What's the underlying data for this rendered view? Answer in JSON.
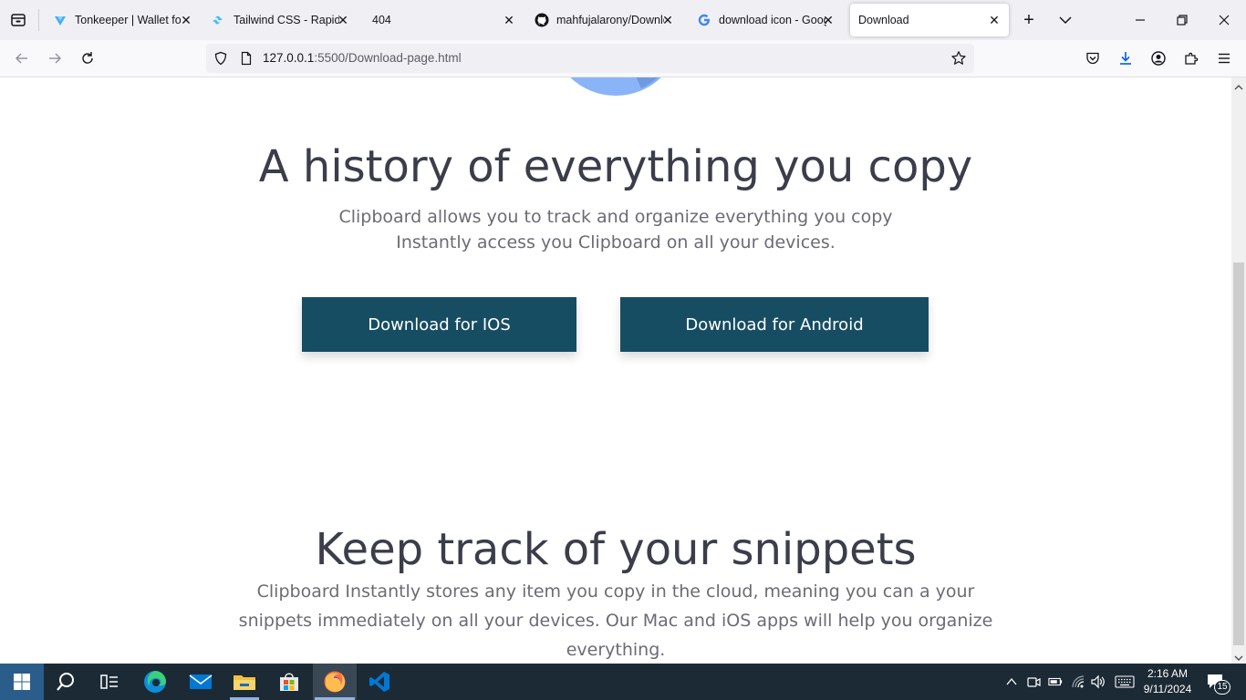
{
  "browser": {
    "tabs": [
      {
        "title": "Tonkeeper | Wallet for",
        "icon": "tonkeeper-icon"
      },
      {
        "title": "Tailwind CSS - Rapidly",
        "icon": "tailwind-icon"
      },
      {
        "title": "404",
        "icon": ""
      },
      {
        "title": "mahfujalarony/Downlo",
        "icon": "github-icon"
      },
      {
        "title": "download icon - Googl",
        "icon": "google-icon"
      },
      {
        "title": "Download",
        "icon": ""
      }
    ],
    "url_host": "127.0.0.1",
    "url_rest": ":5500/Download-page.html"
  },
  "page": {
    "section1": {
      "heading": "A history of everything you copy",
      "line1": "Clipboard allows you to track and organize everything you copy",
      "line2": "Instantly access you Clipboard on all your devices.",
      "btn_ios": "Download for IOS",
      "btn_android": "Download for Android"
    },
    "section2": {
      "heading": "Keep track of your snippets",
      "line1": "Clipboard Instantly stores any item you copy in the cloud, meaning you can a your",
      "line2": "snippets immediately on all your devices. Our Mac and iOS apps will help you organize",
      "line3": "everything."
    }
  },
  "taskbar": {
    "time": "2:16 AM",
    "date": "9/11/2024",
    "notifications": "15"
  },
  "colors": {
    "button_bg": "#174d63",
    "heading": "#3b3d4a",
    "body_text": "#6b6b75"
  }
}
